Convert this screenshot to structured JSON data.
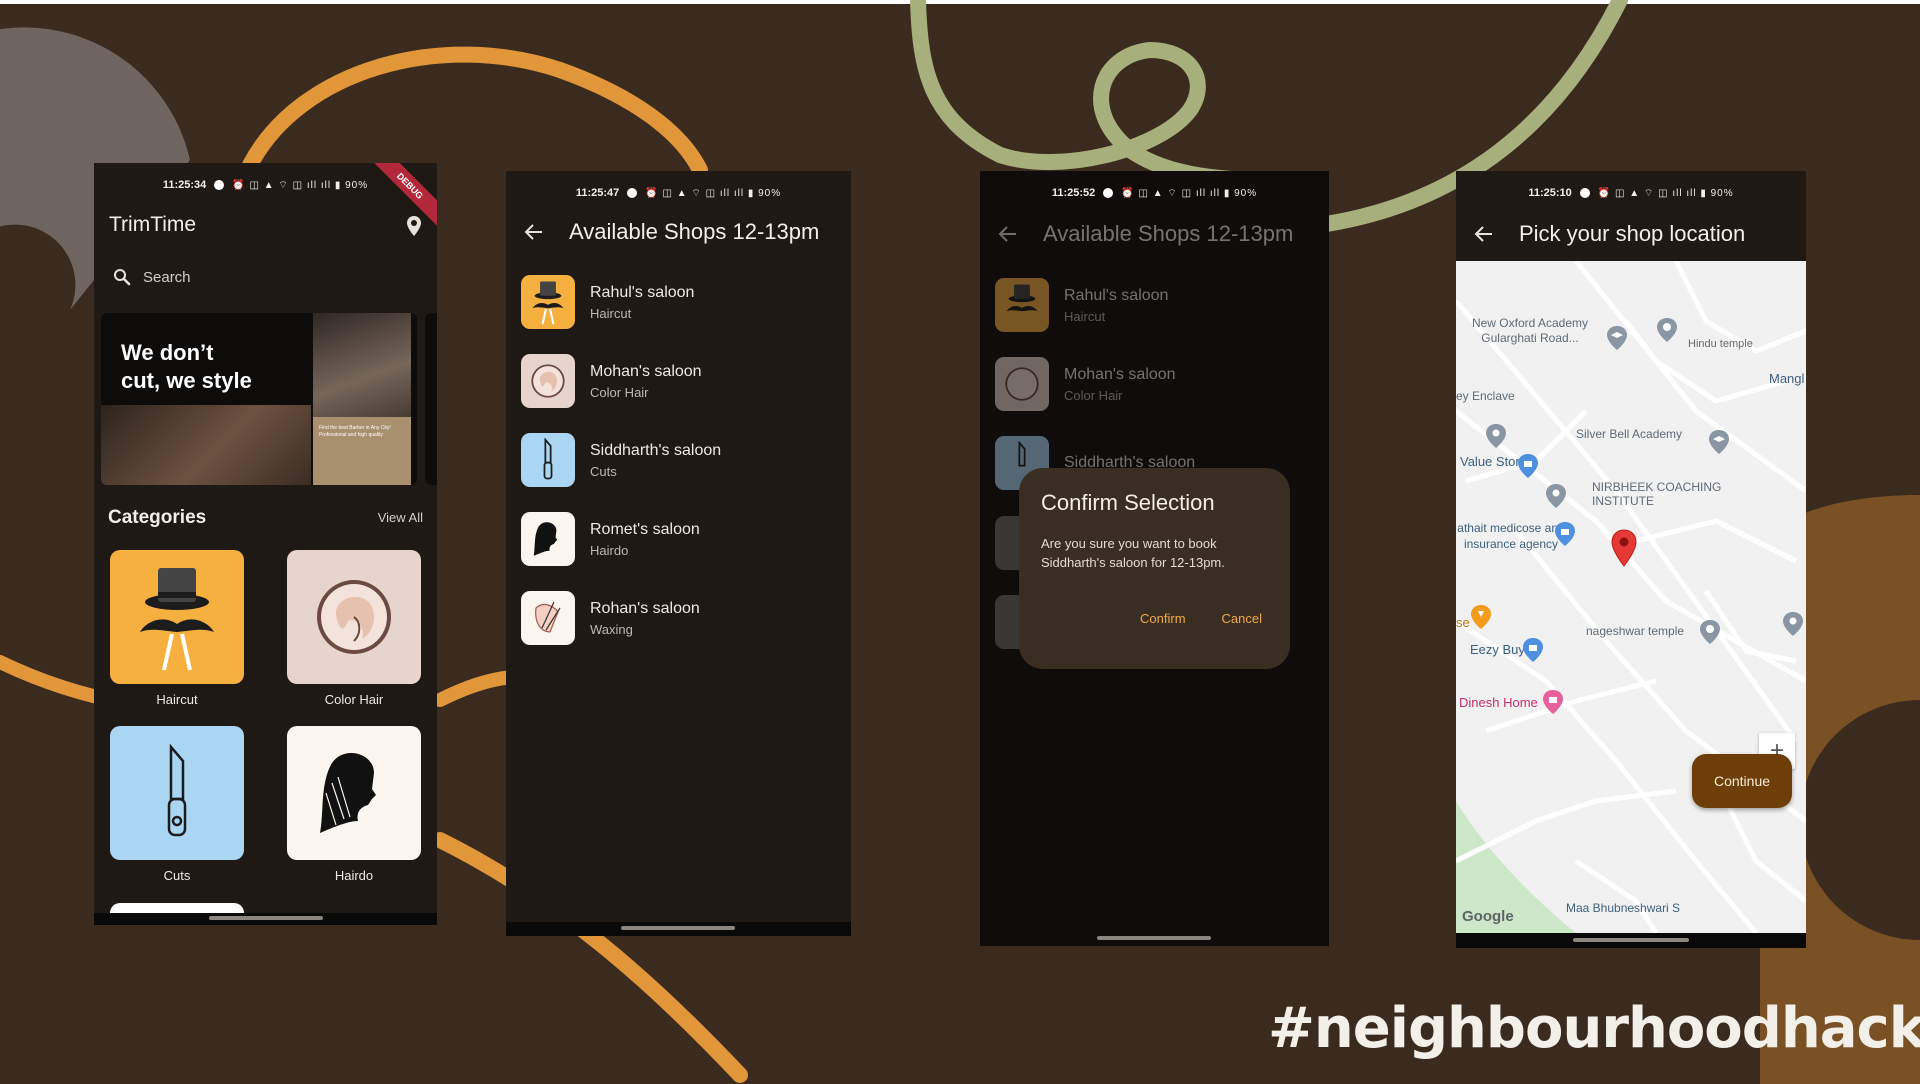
{
  "hashtag": "#neighbourhoodhacks",
  "colors": {
    "background": "#3b2b1f",
    "accent_orange": "#e1963a",
    "accent_green": "#a7b07c",
    "phone_bg": "#1f1915"
  },
  "screen1": {
    "status_time": "11:25:34",
    "status_icons": "⏰ ◫ ▲ ⌔ ◫ ıll ıll ▮ 90%",
    "debug_banner": "DEBUG",
    "app_title": "TrimTime",
    "search_placeholder": "Search",
    "banner_headline_1": "We don’t",
    "banner_headline_2": "cut, we style",
    "banner_small_text": "Find the best Barber in Any City! Professional and high quality",
    "categories_title": "Categories",
    "view_all": "View All",
    "categories": [
      {
        "label": "Haircut",
        "icon": "top-hat-mustache-icon",
        "color": "#f6b040"
      },
      {
        "label": "Color Hair",
        "icon": "woman-portrait-icon",
        "color": "#e7d4cd"
      },
      {
        "label": "Cuts",
        "icon": "razor-icon",
        "color": "#aad6f3"
      },
      {
        "label": "Hairdo",
        "icon": "hair-silhouette-icon",
        "color": "#faf5ee"
      }
    ]
  },
  "screen2": {
    "status_time": "11:25:47",
    "status_icons": "⏰ ◫ ▲ ⌔ ◫ ıll ıll ▮ 90%",
    "title": "Available Shops 12-13pm",
    "shops": [
      {
        "name": "Rahul's saloon",
        "category": "Haircut",
        "icon": "top-hat-mustache-icon",
        "color": "#f6b040"
      },
      {
        "name": "Mohan's saloon",
        "category": "Color Hair",
        "icon": "woman-portrait-icon",
        "color": "#e7d4cd"
      },
      {
        "name": "Siddharth's saloon",
        "category": "Cuts",
        "icon": "razor-icon",
        "color": "#aad6f3"
      },
      {
        "name": "Romet's saloon",
        "category": "Hairdo",
        "icon": "hair-silhouette-icon",
        "color": "#faf5ee"
      },
      {
        "name": "Rohan's saloon",
        "category": "Waxing",
        "icon": "waxing-icon",
        "color": "#faf5ee"
      }
    ]
  },
  "screen3": {
    "status_time": "11:25:52",
    "status_icons": "⏰ ◫ ▲ ⌔ ◫ ıll ıll ▮ 90%",
    "title": "Available Shops 12-13pm",
    "shops": [
      {
        "name": "Rahul's saloon",
        "category": "Haircut"
      },
      {
        "name": "Mohan's saloon",
        "category": "Color Hair"
      },
      {
        "name": "Siddharth's saloon",
        "category": ""
      }
    ],
    "dialog": {
      "title": "Confirm Selection",
      "message": "Are you sure you want to book Siddharth's saloon for 12-13pm.",
      "confirm": "Confirm",
      "cancel": "Cancel"
    }
  },
  "screen4": {
    "status_time": "11:25:10",
    "status_icons": "⏰ ◫ ▲ ⌔ ◫ ıll ıll ▮ 90%",
    "title": "Pick your shop location",
    "map_labels": {
      "new_oxford": "New Oxford Academy Gularghati Road...",
      "hindu_temple": "Hindu temple",
      "mangl": "Mangl",
      "enclave": "ey Enclave",
      "silver_bell": "Silver Bell Academy",
      "value_store": "Value Store",
      "nirbheek": "NIRBHEEK COACHING INSTITUTE",
      "mathait": "athait medicose and insurance agency",
      "se": "se",
      "nageshwar": "nageshwar temple",
      "eezy_buy": "Eezy Buy",
      "dinesh_home": "Dinesh Home",
      "maa_bhubneshwari": "Maa Bhubneshwari S",
      "google": "Google"
    },
    "zoom_in": "+",
    "continue_button": "Continue"
  }
}
